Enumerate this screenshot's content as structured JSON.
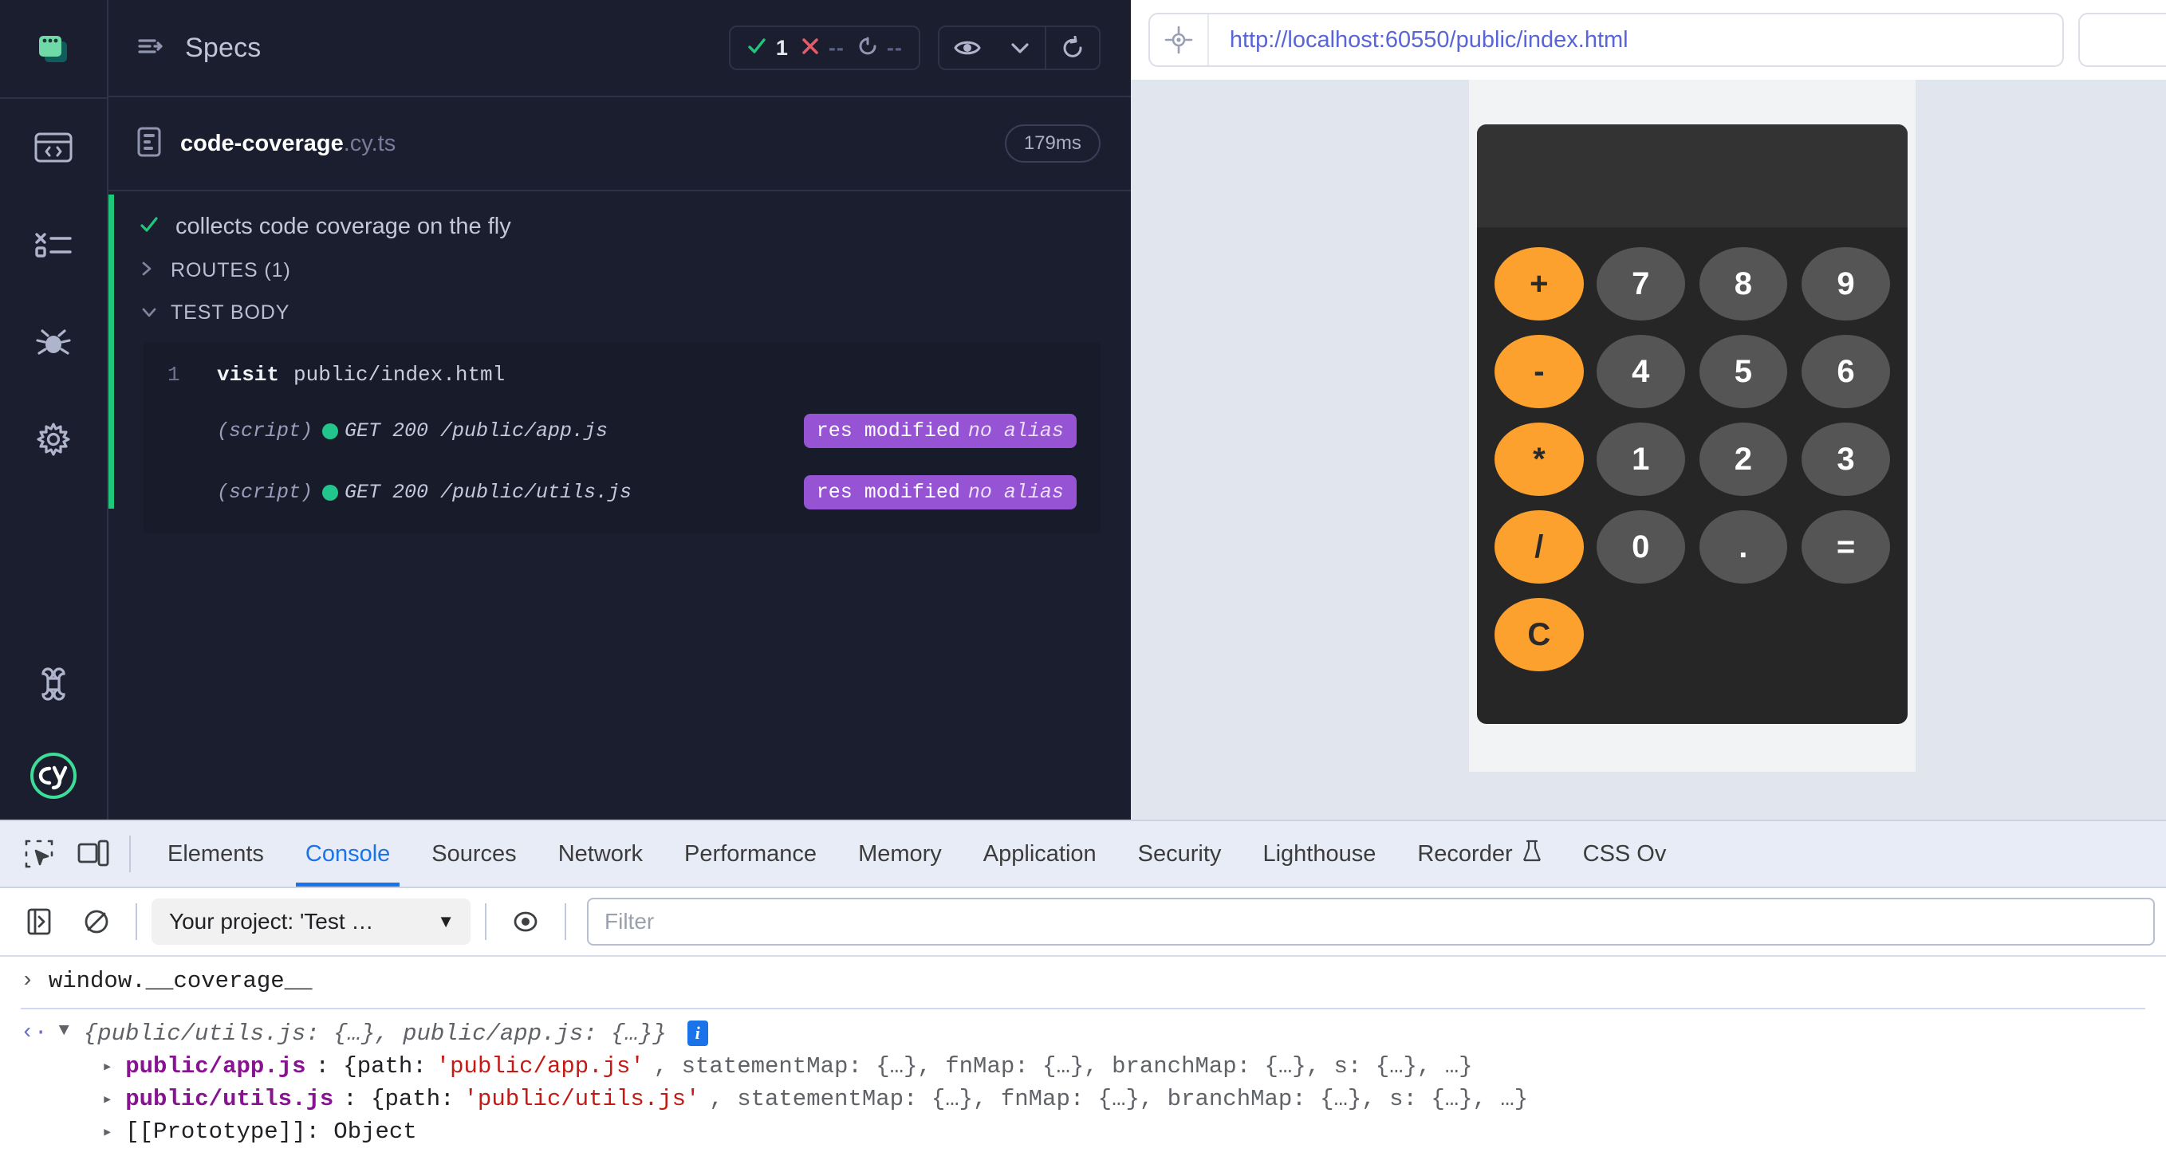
{
  "cypress": {
    "app_logo_icon": "specs-stacked-windows-icon",
    "header": {
      "collapse_icon": "collapse-arrow-icon",
      "title": "Specs",
      "stats": {
        "passed_icon": "check-icon",
        "passed": "1",
        "failed_icon": "x-icon",
        "failed": "--",
        "pending_icon": "circle-dashed-icon",
        "pending": "--"
      },
      "controls": {
        "eye_icon": "eye-icon",
        "chevron_icon": "chevron-down-icon",
        "reload_icon": "reload-icon"
      }
    },
    "sidebar": {
      "items": [
        {
          "icon": "browser-code-icon",
          "name": "sidebar-item-specs"
        },
        {
          "icon": "runs-list-icon",
          "name": "sidebar-item-runs"
        },
        {
          "icon": "debug-bug-icon",
          "name": "sidebar-item-debug"
        },
        {
          "icon": "gear-icon",
          "name": "sidebar-item-settings"
        },
        {
          "icon": "keyboard-command-icon",
          "name": "sidebar-item-shortcuts"
        },
        {
          "icon": "cypress-logo-icon",
          "name": "sidebar-item-cypress-logo"
        }
      ]
    },
    "spec": {
      "file_icon": "spec-file-icon",
      "name_base": "code-coverage",
      "name_ext": ".cy.ts",
      "duration": "179ms"
    },
    "test": {
      "status_icon": "check-icon",
      "title": "collects code coverage on the fly",
      "sections": [
        {
          "chevron": "›",
          "label": "ROUTES (1)",
          "expanded": false
        },
        {
          "chevron": "⌄",
          "label": "TEST BODY",
          "expanded": true
        }
      ],
      "commands": [
        {
          "num": "1",
          "name": "visit",
          "arg": "public/index.html"
        }
      ],
      "routes": [
        {
          "label": "(script)",
          "dot_icon": "status-dot-icon",
          "text": "GET 200 /public/app.js",
          "badge_main": "res modified",
          "badge_alias": "no alias"
        },
        {
          "label": "(script)",
          "dot_icon": "status-dot-icon",
          "text": "GET 200 /public/utils.js",
          "badge_main": "res modified",
          "badge_alias": "no alias"
        }
      ]
    },
    "colors": {
      "pass_green": "#1fc77a",
      "fail_red": "#e45b6a",
      "badge_purple": "#9653d4",
      "panel_bg": "#1b1e2e"
    }
  },
  "browser": {
    "selector_icon": "selector-target-icon",
    "url": "http://localhost:60550/public/index.html"
  },
  "app": {
    "name": "calculator",
    "display_value": "",
    "operators": [
      "+",
      "-",
      "*",
      "/",
      "C"
    ],
    "keys": [
      "7",
      "8",
      "9",
      "4",
      "5",
      "6",
      "1",
      "2",
      "3",
      "0",
      ".",
      "="
    ],
    "colors": {
      "operator": "#fca02e",
      "key": "#555555",
      "body": "#262626"
    }
  },
  "devtools": {
    "tool_icons": [
      {
        "icon": "inspect-element-icon",
        "name": "inspect-element-button"
      },
      {
        "icon": "device-toolbar-icon",
        "name": "device-toolbar-button"
      }
    ],
    "tabs": [
      {
        "label": "Elements",
        "active": false
      },
      {
        "label": "Console",
        "active": true
      },
      {
        "label": "Sources",
        "active": false
      },
      {
        "label": "Network",
        "active": false
      },
      {
        "label": "Performance",
        "active": false
      },
      {
        "label": "Memory",
        "active": false
      },
      {
        "label": "Application",
        "active": false
      },
      {
        "label": "Security",
        "active": false
      },
      {
        "label": "Lighthouse",
        "active": false
      },
      {
        "label": "Recorder",
        "active": false,
        "icon": "flask-icon"
      },
      {
        "label": "CSS Ov",
        "active": false
      }
    ],
    "console_toolbar": {
      "sidebar_icon": "console-sidebar-icon",
      "clear_icon": "clear-console-icon",
      "context_label": "Your project: 'Test …",
      "context_caret": "▼",
      "eye_icon": "live-expression-icon",
      "filter_placeholder": "Filter"
    },
    "console_log": {
      "input_caret": "›",
      "input_text": "window.__coverage__",
      "output_caret": "‹·",
      "output_triangle": "▼",
      "output_preview": "{public/utils.js: {…}, public/app.js: {…}}",
      "info_badge": "i",
      "rows": [
        {
          "triangle": "▸",
          "key": "public/app.js",
          "colon": ": {path: ",
          "string": "'public/app.js'",
          "rest": ", statementMap: {…}, fnMap: {…}, branchMap: {…}, s: {…}, …}"
        },
        {
          "triangle": "▸",
          "key": "public/utils.js",
          "colon": ": {path: ",
          "string": "'public/utils.js'",
          "rest": ", statementMap: {…}, fnMap: {…}, branchMap: {…}, s: {…}, …}"
        }
      ],
      "prototype_row": {
        "triangle": "▸",
        "label": "[[Prototype]]: Object"
      }
    }
  }
}
